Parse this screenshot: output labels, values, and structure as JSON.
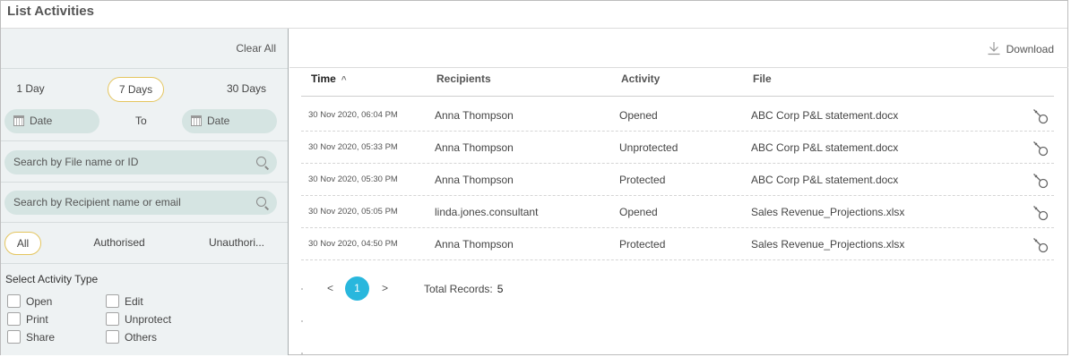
{
  "page": {
    "title": "List Activities"
  },
  "sidebar": {
    "clear_all": "Clear All",
    "ranges": [
      "1 Day",
      "7 Days",
      "30 Days"
    ],
    "selected_range": "7 Days",
    "date_from_placeholder": "Date",
    "to_label": "To",
    "date_to_placeholder": "Date",
    "search_file_placeholder": "Search by File name or ID",
    "search_recipient_placeholder": "Search by Recipient name or email",
    "auth_filters": [
      "All",
      "Authorised",
      "Unauthori..."
    ],
    "selected_auth": "All",
    "activity_type_title": "Select Activity Type",
    "activity_types": [
      "Open",
      "Edit",
      "Print",
      "Unprotect",
      "Share",
      "Others"
    ]
  },
  "main": {
    "download_label": "Download",
    "columns": {
      "time": "Time",
      "recipients": "Recipients",
      "activity": "Activity",
      "file": "File"
    },
    "sort_indicator": "^",
    "rows": [
      {
        "time": "30 Nov 2020, 06:04 PM",
        "recipient": "Anna Thompson",
        "activity": "Opened",
        "file": "ABC Corp P&L statement.docx"
      },
      {
        "time": "30 Nov 2020, 05:33 PM",
        "recipient": "Anna Thompson",
        "activity": "Unprotected",
        "file": "ABC Corp P&L statement.docx"
      },
      {
        "time": "30 Nov 2020, 05:30 PM",
        "recipient": "Anna Thompson",
        "activity": "Protected",
        "file": "ABC Corp P&L statement.docx"
      },
      {
        "time": "30 Nov 2020, 05:05 PM",
        "recipient": "linda.jones.consultant",
        "activity": "Opened",
        "file": "Sales Revenue_Projections.xlsx"
      },
      {
        "time": "30 Nov 2020, 04:50 PM",
        "recipient": "Anna Thompson",
        "activity": "Protected",
        "file": "Sales Revenue_Projections.xlsx"
      }
    ],
    "pagination": {
      "prev": "<",
      "current_page": "1",
      "next": ">",
      "total_label": "Total Records:",
      "total_count": "5"
    }
  },
  "colors": {
    "accent": "#29b7dd",
    "selected_outline": "#e4c55e",
    "sidebar_bg": "#eef2f3",
    "pill_bg": "#d5e4e2"
  },
  "icons": {
    "calendar": "calendar-icon",
    "search": "search-icon",
    "download": "download-icon",
    "row_action": "key-icon"
  }
}
